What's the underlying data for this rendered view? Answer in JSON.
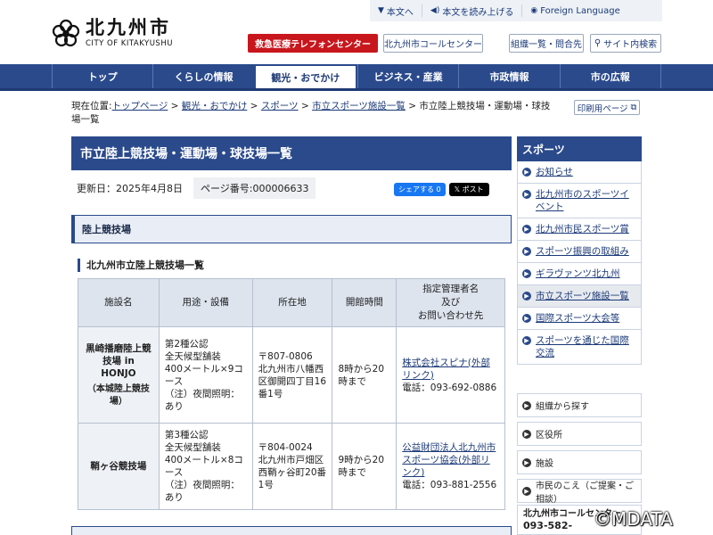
{
  "util": [
    {
      "icon": "▼",
      "label": "本文へ"
    },
    {
      "icon": "◀)",
      "label": "本文を読み上げる"
    },
    {
      "icon": "◉",
      "label": "Foreign Language"
    }
  ],
  "logo": {
    "jp": "北九州市",
    "en": "CITY OF KITAKYUSHU"
  },
  "header": {
    "emergency": "救急医療テレフォンセンター",
    "callcenter": "北九州市コールセンター",
    "orgs": "組織一覧・問合先",
    "search": "サイト内検索"
  },
  "nav": [
    "トップ",
    "くらしの情報",
    "観光・おでかけ",
    "ビジネス・産業",
    "市政情報",
    "市の広報"
  ],
  "breadcrumb": {
    "prefix": "現在位置:",
    "links": [
      "トップページ",
      "観光・おでかけ",
      "スポーツ",
      "市立スポーツ施設一覧"
    ],
    "sep": " > ",
    "current": "市立陸上競技場・運動場・球技場一覧"
  },
  "print": "印刷用ページ",
  "page": {
    "title": "市立陸上競技場・運動場・球技場一覧",
    "updated": "更新日：2025年4月8日",
    "page_id": "ページ番号:000006633",
    "share_fb": "シェアする 0",
    "share_x": "ポスト"
  },
  "section": {
    "h2": "陸上競技場",
    "h3": "北九州市立陸上競技場一覧"
  },
  "table": {
    "headers": [
      "施設名",
      "用途・設備",
      "所在地",
      "開館時間",
      "指定管理者名\n及び\nお問い合わせ先"
    ],
    "rows": [
      {
        "name": "黒崎播磨陸上競技場 in HONJO",
        "name_sub": "（本城陸上競技場）",
        "use": "第2種公認\n全天候型舗装\n400メートル×9コース\n（注）夜間照明：あり",
        "address": "〒807-0806\n北九州市八幡西区御開四丁目16番1号",
        "hours": "8時から20時まで",
        "manager": "株式会社スピナ(外部リンク)",
        "tel": "電話：093-692-0886"
      },
      {
        "name": "鞘ヶ谷競技場",
        "name_sub": "",
        "use": "第3種公認\n全天候型舗装\n400メートル×8コース\n（注）夜間照明：あり",
        "address": "〒804-0024\n北九州市戸畑区西鞘ヶ谷町20番1号",
        "hours": "9時から20時まで",
        "manager": "公益財団法人北九州市スポーツ協会(外部リンク)",
        "tel": "電話：093-881-2556"
      }
    ]
  },
  "side": {
    "heading": "スポーツ",
    "items": [
      "お知らせ",
      "北九州市のスポーツイベント",
      "北九州市民スポーツ賞",
      "スポーツ振興の取組み",
      "ギラヴァンツ北九州",
      "市立スポーツ施設一覧",
      "国際スポーツ大会等",
      "スポーツを通じた国際交流"
    ],
    "current_index": 5,
    "links": [
      "組織から探す",
      "区役所",
      "施設",
      "市民のこえ（ご提案・ご相談）"
    ],
    "call_title": "北九州市コールセンター",
    "call_tel": "093-582-"
  },
  "watermark": "©MDATA",
  "colors": {
    "primary": "#2a4a8c",
    "emergency": "#c8161d"
  }
}
